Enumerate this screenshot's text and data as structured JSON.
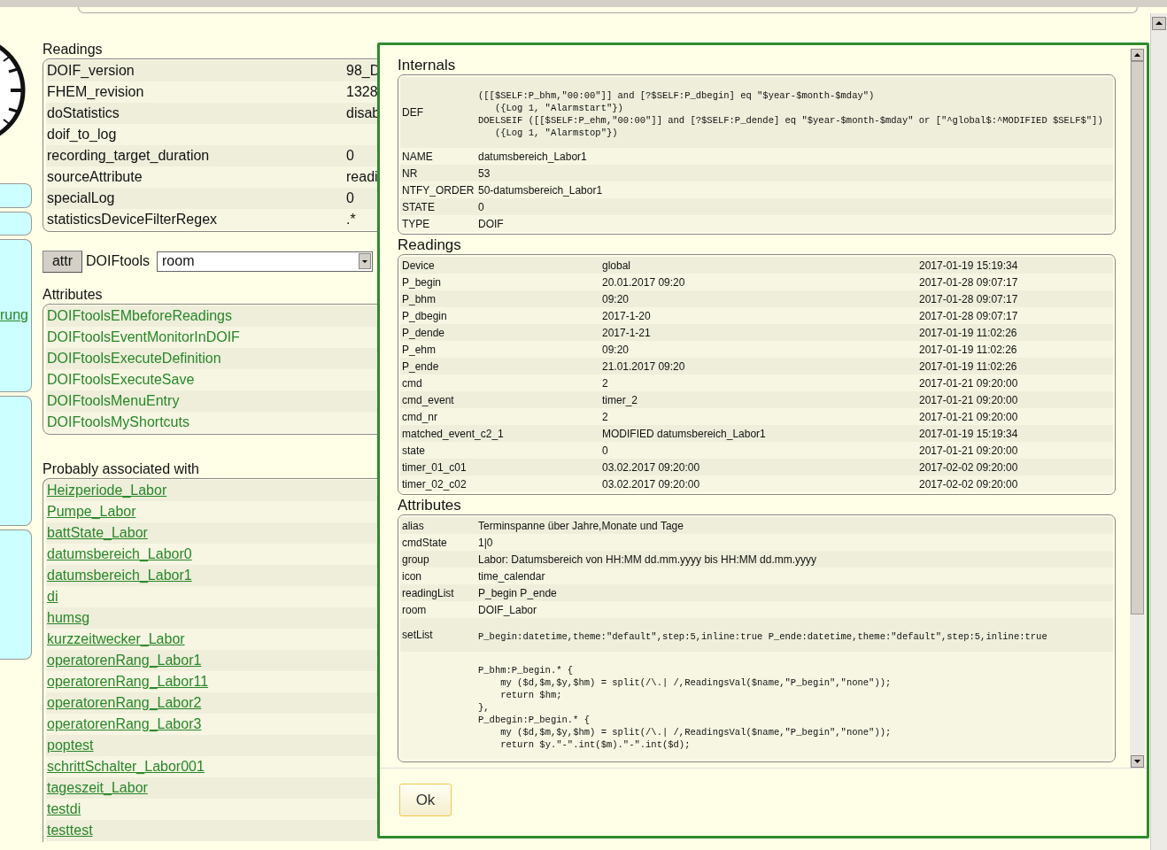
{
  "sidebar": {
    "link": "rung"
  },
  "page": {
    "readings_title": "Readings",
    "readings": [
      {
        "name": "DOIF_version",
        "value": "98_D"
      },
      {
        "name": "FHEM_revision",
        "value": "1328"
      },
      {
        "name": "doStatistics",
        "value": "disab"
      },
      {
        "name": "doif_to_log"
      },
      {
        "name": "recording_target_duration",
        "value": "0"
      },
      {
        "name": "sourceAttribute",
        "value": "readi"
      },
      {
        "name": "specialLog",
        "value": "0"
      },
      {
        "name": "statisticsDeviceFilterRegex",
        "value": ".*"
      }
    ],
    "attr_button": "attr",
    "attr_device": "DOIFtools",
    "attr_select": "room",
    "attributes_title": "Attributes",
    "attributes": [
      "DOIFtoolsEMbeforeReadings",
      "DOIFtoolsEventMonitorInDOIF",
      "DOIFtoolsExecuteDefinition",
      "DOIFtoolsExecuteSave",
      "DOIFtoolsMenuEntry",
      "DOIFtoolsMyShortcuts"
    ],
    "associated_title": "Probably associated with",
    "associated": [
      "Heizperiode_Labor",
      "Pumpe_Labor",
      "battState_Labor",
      "datumsbereich_Labor0",
      "datumsbereich_Labor1",
      "di",
      "humsg",
      "kurzzeitwecker_Labor",
      "operatorenRang_Labor1",
      "operatorenRang_Labor11",
      "operatorenRang_Labor2",
      "operatorenRang_Labor3",
      "poptest",
      "schrittSchalter_Labor001",
      "tageszeit_Labor",
      "testdi",
      "testtest"
    ]
  },
  "dialog": {
    "internals_title": "Internals",
    "internals": [
      {
        "name": "DEF",
        "kind": "code",
        "value": "([[$SELF:P_bhm,\"00:00\"]] and [?$SELF:P_dbegin] eq \"$year-$month-$mday\")\n   ({Log 1, \"Alarmstart\"})\nDOELSEIF ([[$SELF:P_ehm,\"00:00\"]] and [?$SELF:P_dende] eq \"$year-$month-$mday\" or [\"^global$:^MODIFIED $SELF$\"])\n   ({Log 1, \"Alarmstop\"})"
      },
      {
        "name": "NAME",
        "kind": "text",
        "value": "datumsbereich_Labor1"
      },
      {
        "name": "NR",
        "kind": "text",
        "value": "53"
      },
      {
        "name": "NTFY_ORDER",
        "kind": "text",
        "value": "50-datumsbereich_Labor1"
      },
      {
        "name": "STATE",
        "kind": "text",
        "value": "0"
      },
      {
        "name": "TYPE",
        "kind": "text",
        "value": "DOIF"
      }
    ],
    "readings_title": "Readings",
    "readings": [
      {
        "name": "Device",
        "value": "global",
        "time": "2017-01-19 15:19:34"
      },
      {
        "name": "P_begin",
        "value": "20.01.2017 09:20",
        "time": "2017-01-28 09:07:17"
      },
      {
        "name": "P_bhm",
        "value": "09:20",
        "time": "2017-01-28 09:07:17"
      },
      {
        "name": "P_dbegin",
        "value": "2017-1-20",
        "time": "2017-01-28 09:07:17"
      },
      {
        "name": "P_dende",
        "value": "2017-1-21",
        "time": "2017-01-19 11:02:26"
      },
      {
        "name": "P_ehm",
        "value": "09:20",
        "time": "2017-01-19 11:02:26"
      },
      {
        "name": "P_ende",
        "value": "21.01.2017 09:20",
        "time": "2017-01-19 11:02:26"
      },
      {
        "name": "cmd",
        "value": "2",
        "time": "2017-01-21 09:20:00"
      },
      {
        "name": "cmd_event",
        "value": "timer_2",
        "time": "2017-01-21 09:20:00"
      },
      {
        "name": "cmd_nr",
        "value": "2",
        "time": "2017-01-21 09:20:00"
      },
      {
        "name": "matched_event_c2_1",
        "value": "MODIFIED datumsbereich_Labor1",
        "time": "2017-01-19 15:19:34"
      },
      {
        "name": "state",
        "value": "0",
        "time": "2017-01-21 09:20:00"
      },
      {
        "name": "timer_01_c01",
        "value": "03.02.2017 09:20:00",
        "time": "2017-02-02 09:20:00"
      },
      {
        "name": "timer_02_c02",
        "value": "03.02.2017 09:20:00",
        "time": "2017-02-02 09:20:00"
      }
    ],
    "attributes_title": "Attributes",
    "attributes": [
      {
        "name": "alias",
        "kind": "text",
        "value": "Terminspanne über Jahre,Monate und Tage"
      },
      {
        "name": "cmdState",
        "kind": "text",
        "value": "1|0"
      },
      {
        "name": "group",
        "kind": "text",
        "value": "Labor: Datumsbereich von HH:MM dd.mm.yyyy bis HH:MM dd.mm.yyyy"
      },
      {
        "name": "icon",
        "kind": "text",
        "value": "time_calendar"
      },
      {
        "name": "readingList",
        "kind": "text",
        "value": "P_begin P_ende"
      },
      {
        "name": "room",
        "kind": "text",
        "value": "DOIF_Labor"
      },
      {
        "name": "setList",
        "kind": "code",
        "value": "P_begin:datetime,theme:\"default\",step:5,inline:true P_ende:datetime,theme:\"default\",step:5,inline:true"
      },
      {
        "kind": "code",
        "value": "P_bhm:P_begin.* {\n    my ($d,$m,$y,$hm) = split(/\\.| /,ReadingsVal($name,\"P_begin\",\"none\"));\n    return $hm;\n},\nP_dbegin:P_begin.* {\n    my ($d,$m,$y,$hm) = split(/\\.| /,ReadingsVal($name,\"P_begin\",\"none\"));\n    return $y.\"-\".int($m).\"-\".int($d);"
      }
    ],
    "ok_button": "Ok"
  }
}
